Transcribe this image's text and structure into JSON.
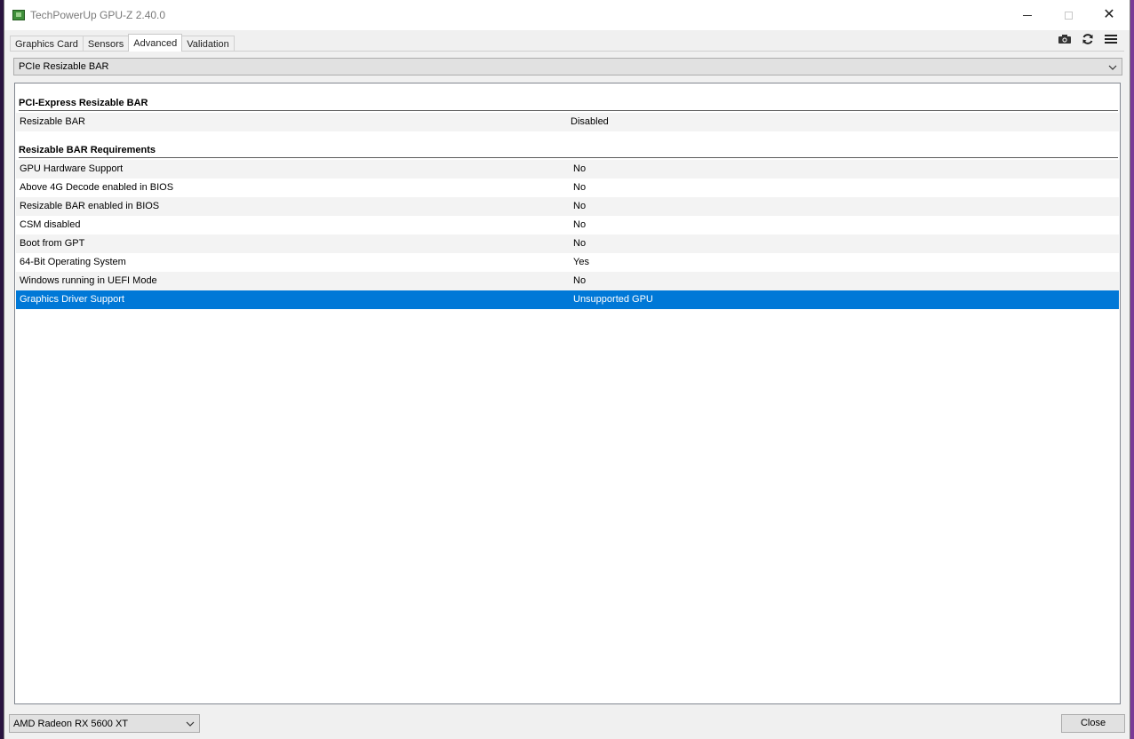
{
  "window": {
    "title": "TechPowerUp GPU-Z 2.40.0",
    "controls": [
      "minimize",
      "maximize",
      "close"
    ]
  },
  "tabs": [
    {
      "label": "Graphics Card",
      "active": false
    },
    {
      "label": "Sensors",
      "active": false
    },
    {
      "label": "Advanced",
      "active": true
    },
    {
      "label": "Validation",
      "active": false
    }
  ],
  "toolbar": {
    "icons": [
      "camera-icon",
      "refresh-icon",
      "menu-icon"
    ]
  },
  "category_select": {
    "value": "PCIe Resizable BAR"
  },
  "sections": {
    "pcie": {
      "heading": "PCI-Express Resizable BAR",
      "rows": [
        {
          "label": "Resizable BAR",
          "value": "Disabled"
        }
      ]
    },
    "requirements": {
      "heading": "Resizable BAR Requirements",
      "rows": [
        {
          "label": "GPU Hardware Support",
          "value": "No"
        },
        {
          "label": "Above 4G Decode enabled in BIOS",
          "value": "No"
        },
        {
          "label": "Resizable BAR enabled in BIOS",
          "value": "No"
        },
        {
          "label": "CSM disabled",
          "value": "No"
        },
        {
          "label": "Boot from GPT",
          "value": "No"
        },
        {
          "label": "64-Bit Operating System",
          "value": "Yes"
        },
        {
          "label": "Windows running in UEFI Mode",
          "value": "No"
        },
        {
          "label": "Graphics Driver Support",
          "value": "Unsupported GPU",
          "selected": true
        }
      ]
    }
  },
  "gpu_select": {
    "value": "AMD Radeon RX 5600 XT"
  },
  "close_button": {
    "label": "Close"
  },
  "colors": {
    "selection": "#0078d7",
    "window_bg": "#f0f0f0"
  }
}
